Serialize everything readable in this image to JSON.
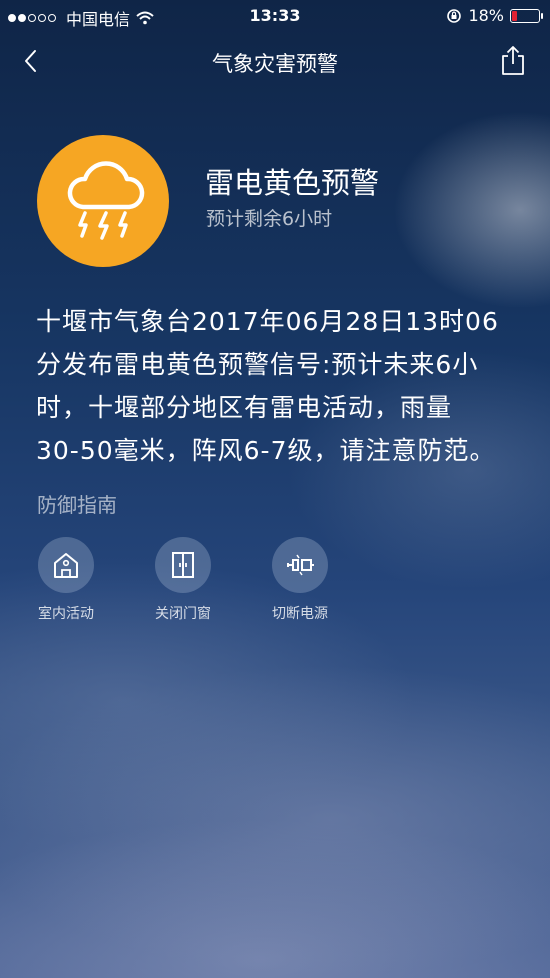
{
  "status_bar": {
    "carrier": "中国电信",
    "time": "13:33",
    "battery": "18%",
    "battery_level": 0.18,
    "battery_color": "#e22233"
  },
  "nav": {
    "title": "气象灾害预警",
    "back_icon": "chevron-left-icon",
    "share_icon": "share-icon"
  },
  "alert": {
    "title": "雷电黄色预警",
    "subtitle": "预计剩余6小时",
    "icon": "thunderstorm-icon",
    "icon_bg_color": "#f6a623",
    "body_lines": [
      "十堰市气象台2017年06月28日13时06",
      "分发布雷电黄色预警信号:预计未来6小",
      "时，十堰部分地区有雷电活动，雨量",
      "30-50毫米，阵风6-7级，请注意防范。"
    ]
  },
  "guide": {
    "title": "防御指南",
    "items": [
      {
        "label": "室内活动",
        "icon": "house-icon"
      },
      {
        "label": "关闭门窗",
        "icon": "door-icon"
      },
      {
        "label": "切断电源",
        "icon": "power-plug-icon"
      }
    ]
  }
}
